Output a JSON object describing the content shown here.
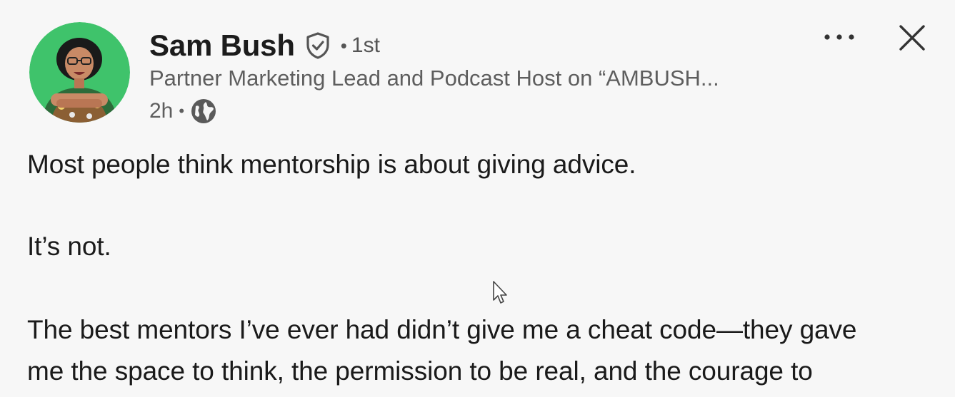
{
  "author": {
    "name": "Sam Bush",
    "degree": "1st",
    "separator": "•",
    "headline": "Partner Marketing Lead and Podcast Host on “AMBUSH...",
    "time": "2h",
    "meta_separator": "•",
    "verified_icon": "shield-check-icon",
    "visibility_icon": "globe-icon"
  },
  "controls": {
    "more_icon": "more-options-icon",
    "close_icon": "close-icon"
  },
  "post": {
    "lines": [
      "Most people think mentorship is about giving advice.",
      "It’s not.",
      "The best mentors I’ve ever had didn’t give me a cheat code—they gave",
      "me the space to think, the permission to be real, and the courage to"
    ]
  },
  "colors": {
    "background": "#f7f7f7",
    "avatar_bg": "#3fc36b",
    "text_primary": "#1c1c1c",
    "text_secondary": "#5e5e5e"
  }
}
